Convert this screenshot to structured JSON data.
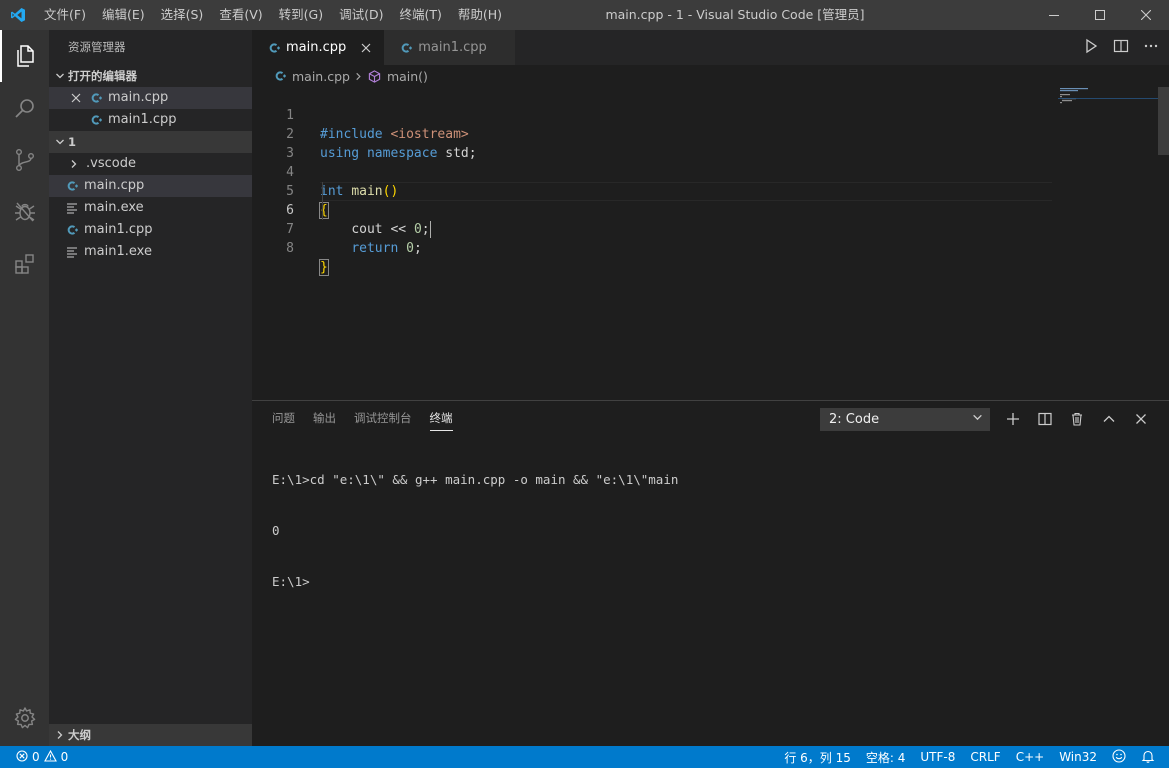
{
  "titlebar": {
    "menu": [
      "文件(F)",
      "编辑(E)",
      "选择(S)",
      "查看(V)",
      "转到(G)",
      "调试(D)",
      "终端(T)",
      "帮助(H)"
    ],
    "window_title": "main.cpp - 1 - Visual Studio Code [管理员]"
  },
  "activitybar": {
    "icons": [
      "explorer-icon",
      "search-icon",
      "source-control-icon",
      "debug-icon",
      "extensions-icon",
      "settings-gear-icon"
    ]
  },
  "sidebar": {
    "title": "资源管理器",
    "open_editors": {
      "header": "打开的编辑器",
      "items": [
        "main.cpp",
        "main1.cpp"
      ]
    },
    "folder": {
      "header": "1",
      "items": [
        ".vscode",
        "main.cpp",
        "main.exe",
        "main1.cpp",
        "main1.exe"
      ]
    },
    "outline_header": "大纲"
  },
  "editor": {
    "tabs": [
      "main.cpp",
      "main1.cpp"
    ],
    "breadcrumb": {
      "file": "main.cpp",
      "symbol": "main()"
    },
    "line_numbers": [
      "1",
      "2",
      "3",
      "4",
      "5",
      "6",
      "7",
      "8"
    ],
    "code": {
      "l1_directive": "#include",
      "l1_header": "<iostream>",
      "l2_kw1": "using",
      "l2_kw2": "namespace",
      "l2_rest": "std;",
      "l4_type": "int",
      "l4_fn": "main",
      "l4_parens": "()",
      "l5_brace": "{",
      "l6_ident": "cout",
      "l6_op": "<<",
      "l6_num": "0",
      "l6_semi": ";",
      "l7_kw": "return",
      "l7_num": "0",
      "l7_semi": ";",
      "l8_brace": "}"
    }
  },
  "panel": {
    "tabs": [
      "问题",
      "输出",
      "调试控制台",
      "终端"
    ],
    "terminal_selected": "2: Code",
    "terminal_lines": [
      "E:\\1>cd \"e:\\1\\\" && g++ main.cpp -o main && \"e:\\1\\\"main",
      "0",
      "E:\\1>"
    ]
  },
  "statusbar": {
    "errors": "0",
    "warnings": "0",
    "position": "行 6，列 15",
    "indent": "空格: 4",
    "encoding": "UTF-8",
    "eol": "CRLF",
    "language": "C++",
    "platform": "Win32"
  },
  "colors": {
    "accent": "#007acc",
    "cpp_icon": "#519aba",
    "keyword": "#569cd6",
    "function": "#dcdcaa",
    "string": "#ce9178",
    "number": "#b5cea8",
    "bracket": "#ffd700"
  }
}
